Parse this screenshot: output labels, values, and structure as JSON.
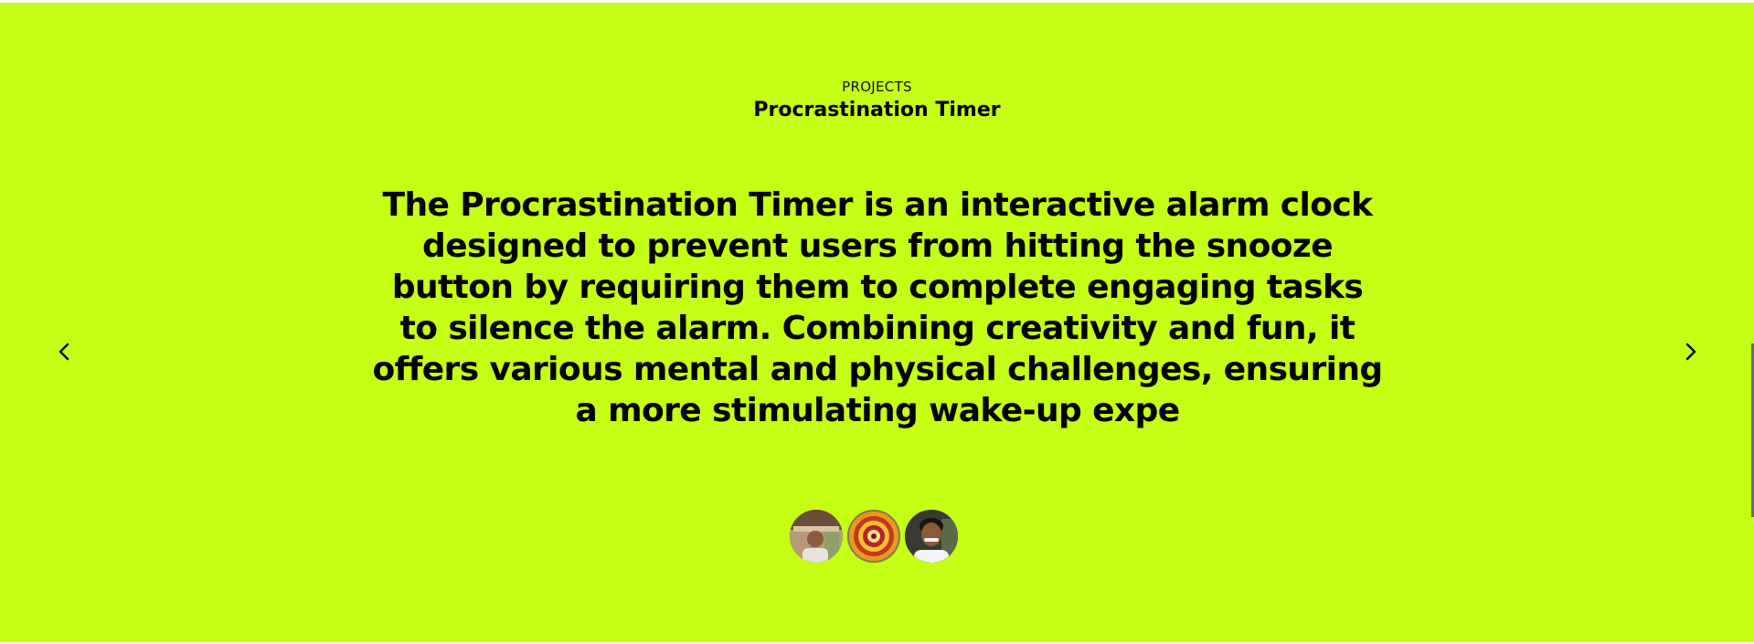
{
  "section": {
    "eyebrow": "PROJECTS",
    "title": "Procrastination Timer",
    "description": "The Procrastination Timer is an interactive alarm clock designed to prevent users from hitting the snooze button by requiring them to complete engaging tasks to silence the alarm. Combining creativity and fun, it offers various mental and physical challenges, ensuring a more stimulating wake-up expe"
  },
  "navigation": {
    "prev_icon": "chevron-left-icon",
    "next_icon": "chevron-right-icon"
  },
  "avatars": [
    {
      "icon": "person-outdoor-avatar"
    },
    {
      "icon": "flower-rangoli-avatar"
    },
    {
      "icon": "person-smiling-avatar"
    }
  ],
  "colors": {
    "background": "#c5ff15",
    "text": "#000000"
  }
}
